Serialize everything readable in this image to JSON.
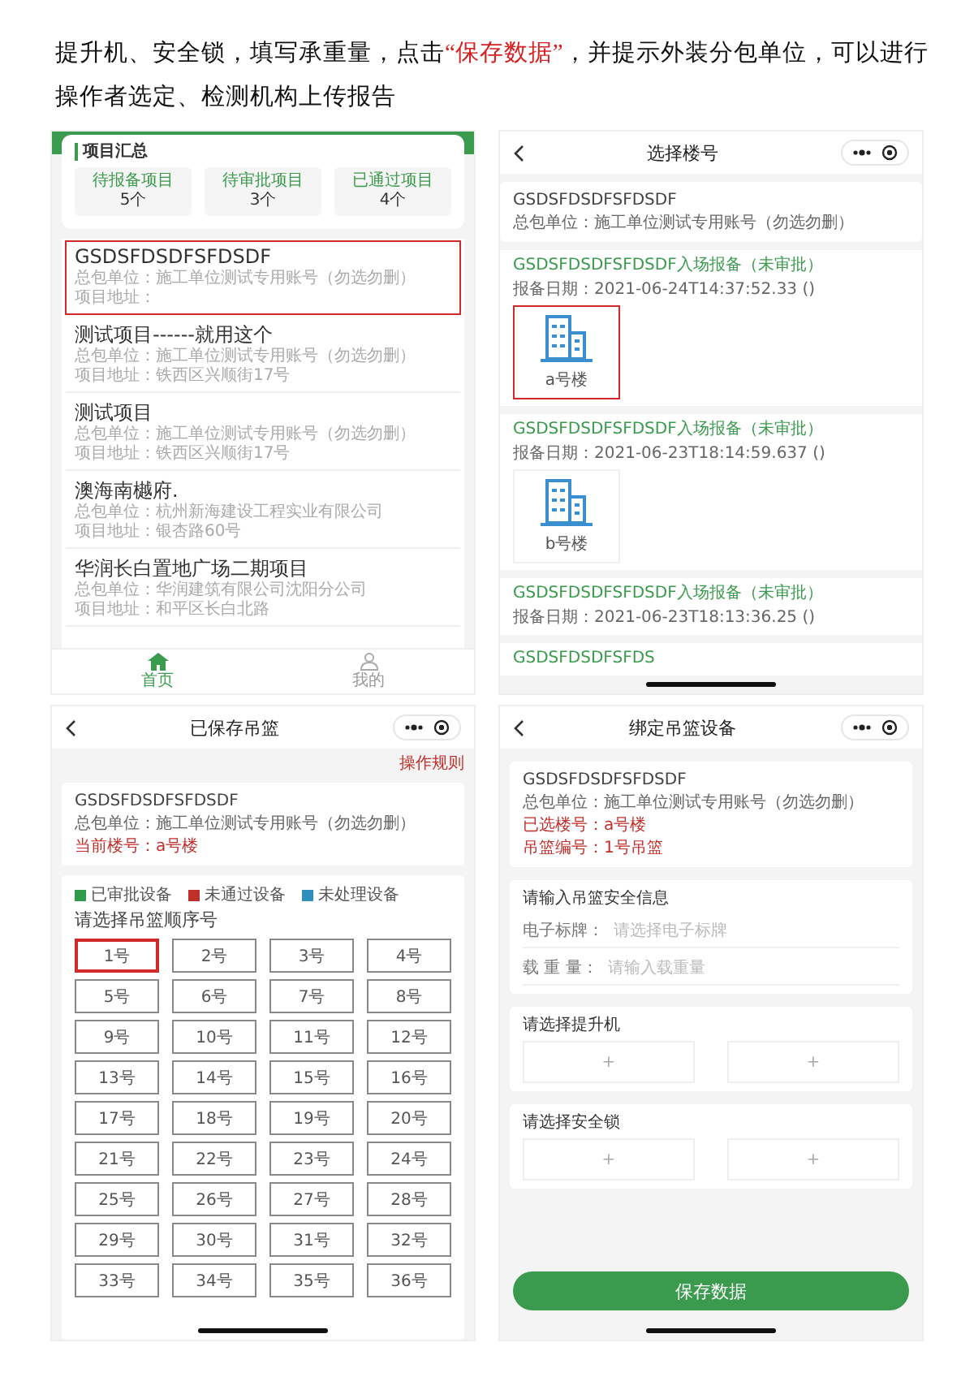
{
  "intro": {
    "parts": [
      {
        "kind": "plain",
        "text": "提升机、安全锁，填写承重量，点击"
      },
      {
        "kind": "highlight",
        "text": "“保存数据”"
      },
      {
        "kind": "plain",
        "text": "，并提示外装分包单位，可以进行操作者选定、检测机构上传报告"
      }
    ]
  },
  "project_list": {
    "summary_title": "项目汇总",
    "stats": [
      {
        "label": "待报备项目",
        "value": "5个"
      },
      {
        "label": "待审批项目",
        "value": "3个"
      },
      {
        "label": "已通过项目",
        "value": "4个"
      }
    ],
    "projects": [
      {
        "name": "GSDSFDSDFSFDSDF",
        "lines": [
          "总包单位：施工单位测试专用账号（勿选勿删）",
          "项目地址："
        ],
        "selected": true
      },
      {
        "name": "测试项目------就用这个",
        "lines": [
          "总包单位：施工单位测试专用账号（勿选勿删）",
          "项目地址：铁西区兴顺街17号"
        ],
        "selected": false
      },
      {
        "name": "测试项目",
        "lines": [
          "总包单位：施工单位测试专用账号（勿选勿删）",
          "项目地址：铁西区兴顺街17号"
        ],
        "selected": false
      },
      {
        "name": "澳海南樾府.",
        "lines": [
          "总包单位：杭州新海建设工程实业有限公司",
          "项目地址：银杏路60号"
        ],
        "selected": false
      },
      {
        "name": "华润长白置地广场二期项目",
        "lines": [
          "总包单位：华润建筑有限公司沈阳分公司",
          "项目地址：和平区长白北路"
        ],
        "selected": false
      }
    ],
    "tabs": [
      {
        "label": "首页",
        "selected": true
      },
      {
        "label": "我的",
        "selected": false
      }
    ]
  },
  "building_select": {
    "title": "选择楼号",
    "project": {
      "name": "GSDSFDSDFSFDSDF",
      "contractor": "总包单位：施工单位测试专用账号（勿选勿删）"
    },
    "reports": [
      {
        "title": "GSDSFDSDFSFDSDF入场报备（未审批）",
        "date": "报备日期：2021-06-24T14:37:52.33 ()",
        "buildings": [
          {
            "label": "a号楼",
            "selected": true
          }
        ]
      },
      {
        "title": "GSDSFDSDFSFDSDF入场报备（未审批）",
        "date": "报备日期：2021-06-23T18:14:59.637 ()",
        "buildings": [
          {
            "label": "b号楼",
            "selected": false
          }
        ]
      },
      {
        "title": "GSDSFDSDFSFDSDF入场报备（未审批）",
        "date": "报备日期：2021-06-23T18:13:36.25 ()"
      },
      {
        "title": "GSDSFDSDFSFDS"
      }
    ]
  },
  "saved_baskets": {
    "title": "已保存吊篮",
    "rules_link": "操作规则",
    "project": {
      "name": "GSDSFDSDFSFDSDF",
      "contractor": "总包单位：施工单位测试专用账号（勿选勿删）",
      "current": "当前楼号：a号楼"
    },
    "legend": [
      {
        "label": "已审批设备",
        "color": "#2e9a4a"
      },
      {
        "label": "未通过设备",
        "color": "#c0302b"
      },
      {
        "label": "未处理设备",
        "color": "#2f8ec0"
      }
    ],
    "prompt": "请选择吊篮顺序号",
    "slots": [
      {
        "label": "1号",
        "selected": true
      },
      {
        "label": "2号",
        "selected": false
      },
      {
        "label": "3号",
        "selected": false
      },
      {
        "label": "4号",
        "selected": false
      },
      {
        "label": "5号",
        "selected": false
      },
      {
        "label": "6号",
        "selected": false
      },
      {
        "label": "7号",
        "selected": false
      },
      {
        "label": "8号",
        "selected": false
      },
      {
        "label": "9号",
        "selected": false
      },
      {
        "label": "10号",
        "selected": false
      },
      {
        "label": "11号",
        "selected": false
      },
      {
        "label": "12号",
        "selected": false
      },
      {
        "label": "13号",
        "selected": false
      },
      {
        "label": "14号",
        "selected": false
      },
      {
        "label": "15号",
        "selected": false
      },
      {
        "label": "16号",
        "selected": false
      },
      {
        "label": "17号",
        "selected": false
      },
      {
        "label": "18号",
        "selected": false
      },
      {
        "label": "19号",
        "selected": false
      },
      {
        "label": "20号",
        "selected": false
      },
      {
        "label": "21号",
        "selected": false
      },
      {
        "label": "22号",
        "selected": false
      },
      {
        "label": "23号",
        "selected": false
      },
      {
        "label": "24号",
        "selected": false
      },
      {
        "label": "25号",
        "selected": false
      },
      {
        "label": "26号",
        "selected": false
      },
      {
        "label": "27号",
        "selected": false
      },
      {
        "label": "28号",
        "selected": false
      },
      {
        "label": "29号",
        "selected": false
      },
      {
        "label": "30号",
        "selected": false
      },
      {
        "label": "31号",
        "selected": false
      },
      {
        "label": "32号",
        "selected": false
      },
      {
        "label": "33号",
        "selected": false
      },
      {
        "label": "34号",
        "selected": false
      },
      {
        "label": "35号",
        "selected": false
      },
      {
        "label": "36号",
        "selected": false
      }
    ]
  },
  "bind_device": {
    "title": "绑定吊篮设备",
    "project": {
      "name": "GSDSFDSDFSFDSDF",
      "contractor": "总包单位：施工单位测试专用账号（勿选勿删）",
      "details": [
        "已选楼号：a号楼",
        "吊篮编号：1号吊篮"
      ]
    },
    "info": {
      "title": "请输入吊篮安全信息",
      "fields": [
        {
          "label": "电子标牌：",
          "placeholder": "请选择电子标牌"
        },
        {
          "label": "载 重 量：",
          "placeholder": "请输入载重量"
        }
      ]
    },
    "pickers": [
      {
        "title": "请选择提升机",
        "slots": [
          "+",
          "+"
        ]
      },
      {
        "title": "请选择安全锁",
        "slots": [
          "+",
          "+"
        ]
      }
    ],
    "save_button": "保存数据"
  }
}
